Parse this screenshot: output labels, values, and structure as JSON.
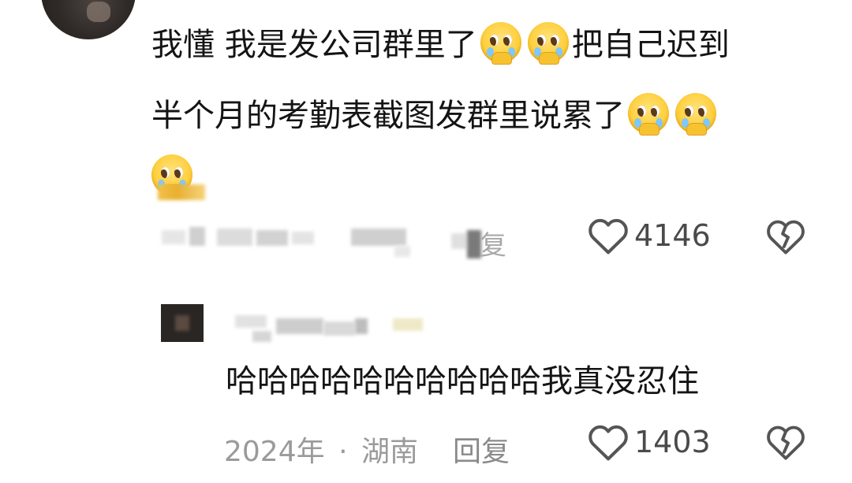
{
  "main_comment": {
    "line1_a": "我懂  我是发公司群里了",
    "line1_b": "把自己迟到",
    "line2": "半个月的考勤表截图发群里说累了",
    "meta_partial_char": "复",
    "like_count": "4146"
  },
  "reply": {
    "text": "哈哈哈哈哈哈哈哈哈哈我真没忍住",
    "date": "2024年",
    "separator": "·",
    "location": "湖南",
    "reply_label": "回复",
    "like_count": "1403"
  },
  "icons": {
    "emoji": "pleading-face-crying-emoji",
    "like": "heart-outline-icon",
    "dislike": "broken-heart-icon"
  },
  "colors": {
    "text": "#141414",
    "meta": "#9a9a9a",
    "icon": "#555555"
  }
}
